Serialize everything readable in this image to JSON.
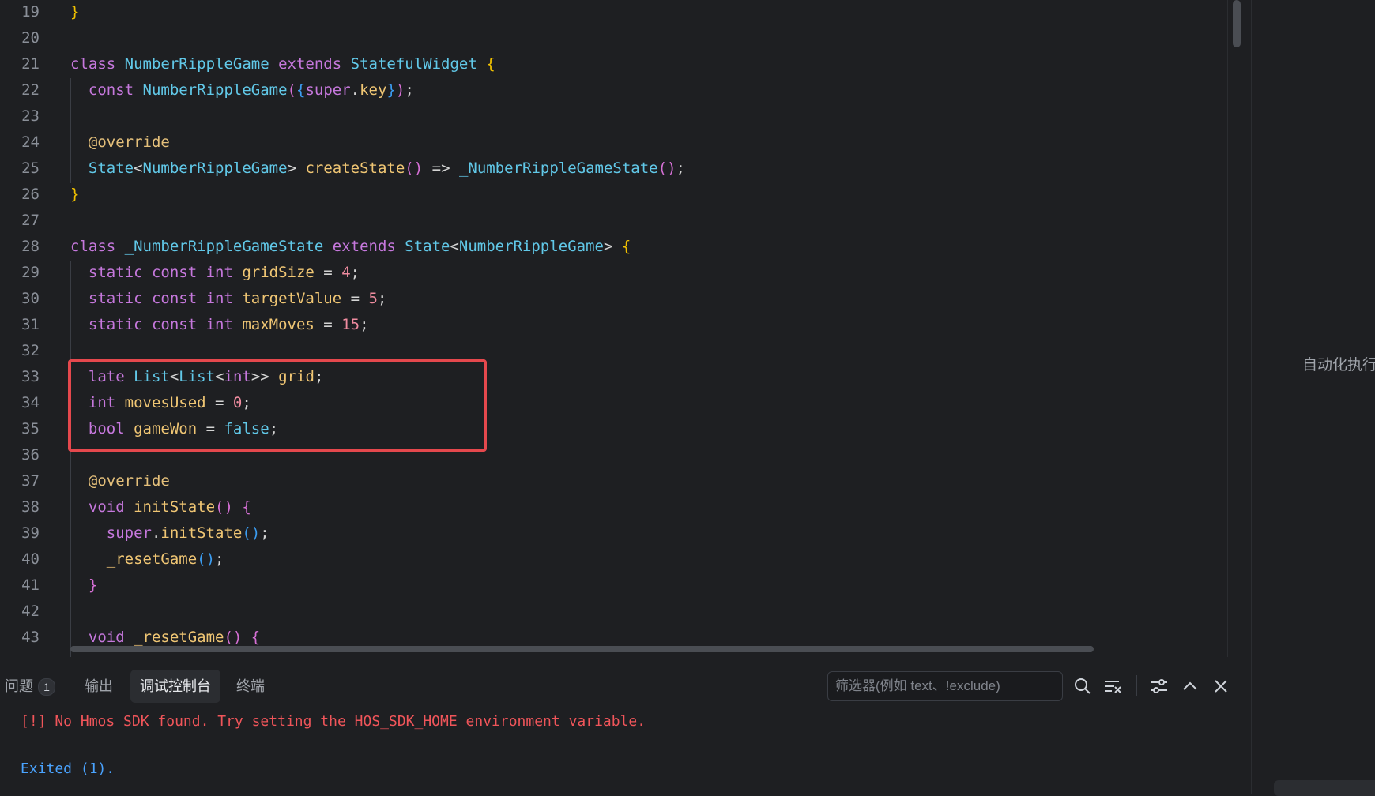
{
  "editor": {
    "lines": [
      {
        "n": "19",
        "tokens": [
          {
            "t": "}",
            "c": "br1"
          }
        ]
      },
      {
        "n": "20",
        "tokens": []
      },
      {
        "n": "21",
        "tokens": [
          {
            "t": "class ",
            "c": "kw"
          },
          {
            "t": "NumberRippleGame ",
            "c": "typ"
          },
          {
            "t": "extends ",
            "c": "kw"
          },
          {
            "t": "StatefulWidget ",
            "c": "typ"
          },
          {
            "t": "{",
            "c": "br1"
          }
        ]
      },
      {
        "n": "22",
        "tokens": [
          {
            "t": "  const ",
            "c": "kw"
          },
          {
            "t": "NumberRippleGame",
            "c": "typ"
          },
          {
            "t": "(",
            "c": "br2"
          },
          {
            "t": "{",
            "c": "br3"
          },
          {
            "t": "super",
            "c": "kw"
          },
          {
            "t": ".",
            "c": "op"
          },
          {
            "t": "key",
            "c": "fn"
          },
          {
            "t": "}",
            "c": "br3"
          },
          {
            "t": ")",
            "c": "br2"
          },
          {
            "t": ";",
            "c": "op"
          }
        ]
      },
      {
        "n": "23",
        "tokens": []
      },
      {
        "n": "24",
        "tokens": [
          {
            "t": "  @override",
            "c": "ann"
          }
        ]
      },
      {
        "n": "25",
        "tokens": [
          {
            "t": "  State",
            "c": "typ"
          },
          {
            "t": "<",
            "c": "op"
          },
          {
            "t": "NumberRippleGame",
            "c": "typ"
          },
          {
            "t": "> ",
            "c": "op"
          },
          {
            "t": "createState",
            "c": "fn"
          },
          {
            "t": "()",
            "c": "br2"
          },
          {
            "t": " => ",
            "c": "op"
          },
          {
            "t": "_NumberRippleGameState",
            "c": "typ"
          },
          {
            "t": "()",
            "c": "br2"
          },
          {
            "t": ";",
            "c": "op"
          }
        ]
      },
      {
        "n": "26",
        "tokens": [
          {
            "t": "}",
            "c": "br1"
          }
        ]
      },
      {
        "n": "27",
        "tokens": []
      },
      {
        "n": "28",
        "tokens": [
          {
            "t": "class ",
            "c": "kw"
          },
          {
            "t": "_NumberRippleGameState ",
            "c": "typ"
          },
          {
            "t": "extends ",
            "c": "kw"
          },
          {
            "t": "State",
            "c": "typ"
          },
          {
            "t": "<",
            "c": "op"
          },
          {
            "t": "NumberRippleGame",
            "c": "typ"
          },
          {
            "t": "> ",
            "c": "op"
          },
          {
            "t": "{",
            "c": "br1"
          }
        ]
      },
      {
        "n": "29",
        "tokens": [
          {
            "t": "  static const int ",
            "c": "kw"
          },
          {
            "t": "gridSize",
            "c": "fn"
          },
          {
            "t": " = ",
            "c": "op"
          },
          {
            "t": "4",
            "c": "num"
          },
          {
            "t": ";",
            "c": "op"
          }
        ]
      },
      {
        "n": "30",
        "tokens": [
          {
            "t": "  static const int ",
            "c": "kw"
          },
          {
            "t": "targetValue",
            "c": "fn"
          },
          {
            "t": " = ",
            "c": "op"
          },
          {
            "t": "5",
            "c": "num"
          },
          {
            "t": ";",
            "c": "op"
          }
        ]
      },
      {
        "n": "31",
        "tokens": [
          {
            "t": "  static const int ",
            "c": "kw"
          },
          {
            "t": "maxMoves",
            "c": "fn"
          },
          {
            "t": " = ",
            "c": "op"
          },
          {
            "t": "15",
            "c": "num"
          },
          {
            "t": ";",
            "c": "op"
          }
        ]
      },
      {
        "n": "32",
        "tokens": []
      },
      {
        "n": "33",
        "tokens": [
          {
            "t": "  late ",
            "c": "kw"
          },
          {
            "t": "List",
            "c": "typ"
          },
          {
            "t": "<",
            "c": "op"
          },
          {
            "t": "List",
            "c": "typ"
          },
          {
            "t": "<",
            "c": "op"
          },
          {
            "t": "int",
            "c": "kw"
          },
          {
            "t": ">> ",
            "c": "op"
          },
          {
            "t": "grid",
            "c": "fn"
          },
          {
            "t": ";",
            "c": "op"
          }
        ]
      },
      {
        "n": "34",
        "tokens": [
          {
            "t": "  int ",
            "c": "kw"
          },
          {
            "t": "movesUsed",
            "c": "fn"
          },
          {
            "t": " = ",
            "c": "op"
          },
          {
            "t": "0",
            "c": "num"
          },
          {
            "t": ";",
            "c": "op"
          }
        ]
      },
      {
        "n": "35",
        "tokens": [
          {
            "t": "  bool ",
            "c": "kw"
          },
          {
            "t": "gameWon",
            "c": "fn"
          },
          {
            "t": " = ",
            "c": "op"
          },
          {
            "t": "false",
            "c": "typ"
          },
          {
            "t": ";",
            "c": "op"
          }
        ]
      },
      {
        "n": "36",
        "tokens": []
      },
      {
        "n": "37",
        "tokens": [
          {
            "t": "  @override",
            "c": "ann"
          }
        ]
      },
      {
        "n": "38",
        "tokens": [
          {
            "t": "  void ",
            "c": "kw"
          },
          {
            "t": "initState",
            "c": "fn"
          },
          {
            "t": "() ",
            "c": "br2"
          },
          {
            "t": "{",
            "c": "br2"
          }
        ]
      },
      {
        "n": "39",
        "tokens": [
          {
            "t": "    super",
            "c": "kw"
          },
          {
            "t": ".",
            "c": "op"
          },
          {
            "t": "initState",
            "c": "fn"
          },
          {
            "t": "()",
            "c": "br3"
          },
          {
            "t": ";",
            "c": "op"
          }
        ]
      },
      {
        "n": "40",
        "tokens": [
          {
            "t": "    _resetGame",
            "c": "fn"
          },
          {
            "t": "()",
            "c": "br3"
          },
          {
            "t": ";",
            "c": "op"
          }
        ]
      },
      {
        "n": "41",
        "tokens": [
          {
            "t": "  }",
            "c": "br2"
          }
        ]
      },
      {
        "n": "42",
        "tokens": []
      },
      {
        "n": "43",
        "tokens": [
          {
            "t": "  void ",
            "c": "kw"
          },
          {
            "t": "_resetGame",
            "c": "fn"
          },
          {
            "t": "() ",
            "c": "br2"
          },
          {
            "t": "{",
            "c": "br2"
          }
        ]
      }
    ]
  },
  "right_panel": {
    "text": "自动化执行"
  },
  "bottom_panel": {
    "tabs": [
      {
        "label": "问题",
        "badge": "1",
        "active": false
      },
      {
        "label": "输出",
        "active": false
      },
      {
        "label": "调试控制台",
        "active": true
      },
      {
        "label": "终端",
        "active": false
      }
    ],
    "filter_placeholder": "筛选器(例如 text、!exclude)",
    "console": {
      "error": "[!] No Hmos SDK found. Try setting the HOS_SDK_HOME environment variable.",
      "exit": "Exited (1)."
    },
    "icons": [
      "search-icon",
      "clear-console-icon",
      "filter-settings-icon",
      "chevron-up-icon",
      "close-icon"
    ]
  },
  "colors": {
    "background": "#1e1f22",
    "highlight_border": "#e5484d",
    "error_text": "#f0555a",
    "exit_text": "#4aa3ff"
  }
}
